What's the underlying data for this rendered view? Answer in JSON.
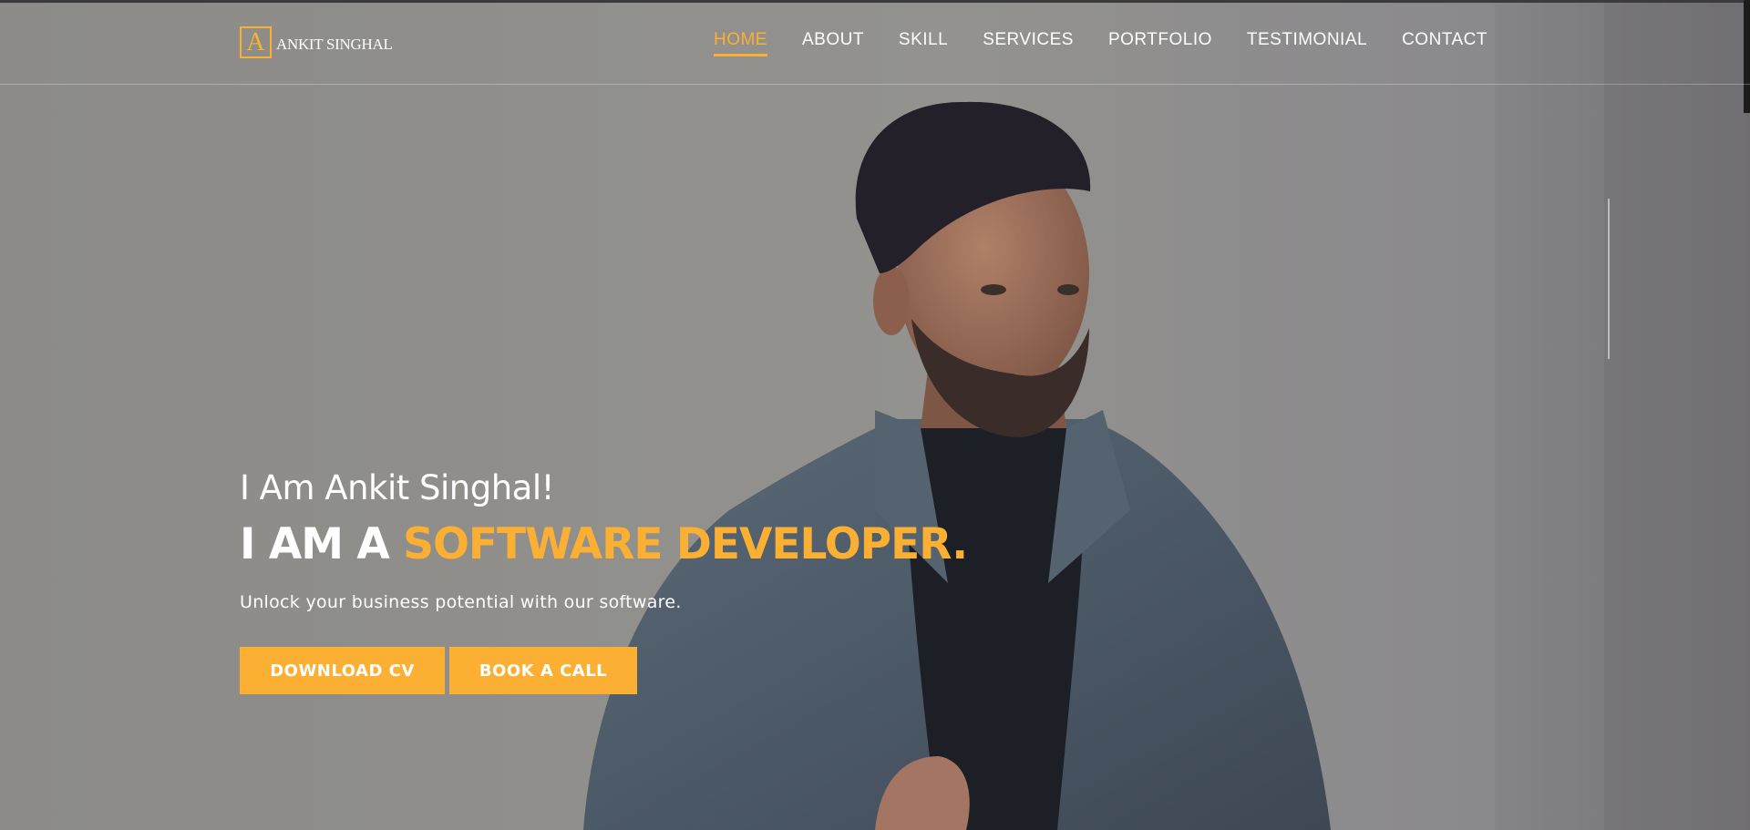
{
  "colors": {
    "accent": "#fbb034",
    "text": "#ffffff",
    "background": "#8d8c88"
  },
  "logo": {
    "mark": "A",
    "text": "ANKIT SINGHAL"
  },
  "nav": {
    "items": [
      {
        "label": "HOME",
        "active": true
      },
      {
        "label": "ABOUT",
        "active": false
      },
      {
        "label": "SKILL",
        "active": false
      },
      {
        "label": "SERVICES",
        "active": false
      },
      {
        "label": "PORTFOLIO",
        "active": false
      },
      {
        "label": "TESTIMONIAL",
        "active": false
      },
      {
        "label": "CONTACT",
        "active": false
      }
    ]
  },
  "hero": {
    "greeting": "I Am Ankit Singhal!",
    "headline_prefix": "I AM A",
    "headline_accent": "SOFTWARE DEVELOPER.",
    "tagline": "Unlock your business potential with our software.",
    "buttons": {
      "download_cv": "DOWNLOAD CV",
      "book_call": "BOOK A CALL"
    },
    "photo_icon": "portrait-photo"
  }
}
